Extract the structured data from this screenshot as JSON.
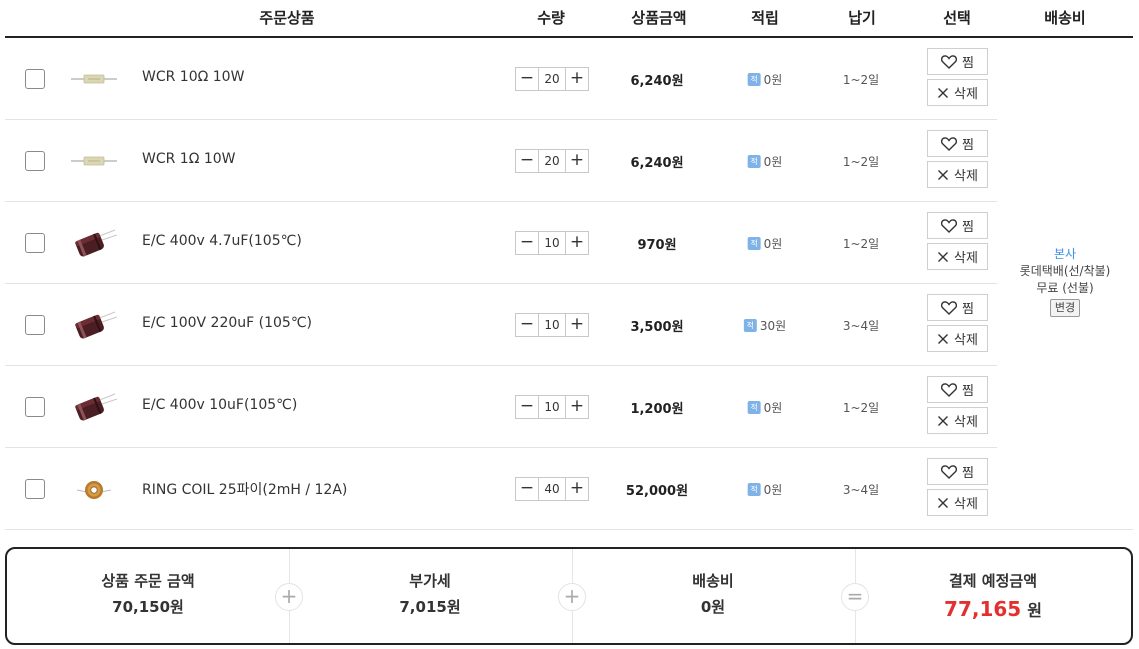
{
  "header": {
    "product": "주문상품",
    "qty": "수량",
    "price": "상품금액",
    "point": "적립",
    "delivery": "납기",
    "select": "선택",
    "shipping": "배송비"
  },
  "icons": {
    "point_badge": "적",
    "wish": "heart-icon",
    "delete": "close-icon",
    "plus": "plus-icon",
    "minus": "minus-icon"
  },
  "buttons": {
    "wish": "찜",
    "delete": "삭제"
  },
  "items": [
    {
      "name": "WCR 10Ω 10W",
      "qty": "20",
      "price": "6,240원",
      "point": "0원",
      "delivery": "1~2일",
      "image": "resistor"
    },
    {
      "name": "WCR 1Ω 10W",
      "qty": "20",
      "price": "6,240원",
      "point": "0원",
      "delivery": "1~2일",
      "image": "resistor"
    },
    {
      "name": "E/C 400v 4.7uF(105℃)",
      "qty": "10",
      "price": "970원",
      "point": "0원",
      "delivery": "1~2일",
      "image": "capacitor"
    },
    {
      "name": "E/C 100V 220uF (105℃)",
      "qty": "10",
      "price": "3,500원",
      "point": "30원",
      "delivery": "3~4일",
      "image": "capacitor"
    },
    {
      "name": "E/C 400v 10uF(105℃)",
      "qty": "10",
      "price": "1,200원",
      "point": "0원",
      "delivery": "1~2일",
      "image": "capacitor"
    },
    {
      "name": "RING COIL 25파이(2mH / 12A)",
      "qty": "40",
      "price": "52,000원",
      "point": "0원",
      "delivery": "3~4일",
      "image": "coil"
    }
  ],
  "shipping": {
    "origin": "본사",
    "method": "롯데택배(선/착불)",
    "fee": "무료 (선불)",
    "change": "변경"
  },
  "summary": {
    "order_label": "상품 주문 금액",
    "order_value": "70,150원",
    "vat_label": "부가세",
    "vat_value": "7,015원",
    "ship_label": "배송비",
    "ship_value": "0원",
    "total_label": "결제 예정금액",
    "total_value": "77,165",
    "total_unit": "원",
    "op_plus": "+",
    "op_equal": "="
  },
  "colors": {
    "accent_red": "#e3302f",
    "link_blue": "#3a8ee6",
    "badge_blue": "#7fb3e8"
  }
}
